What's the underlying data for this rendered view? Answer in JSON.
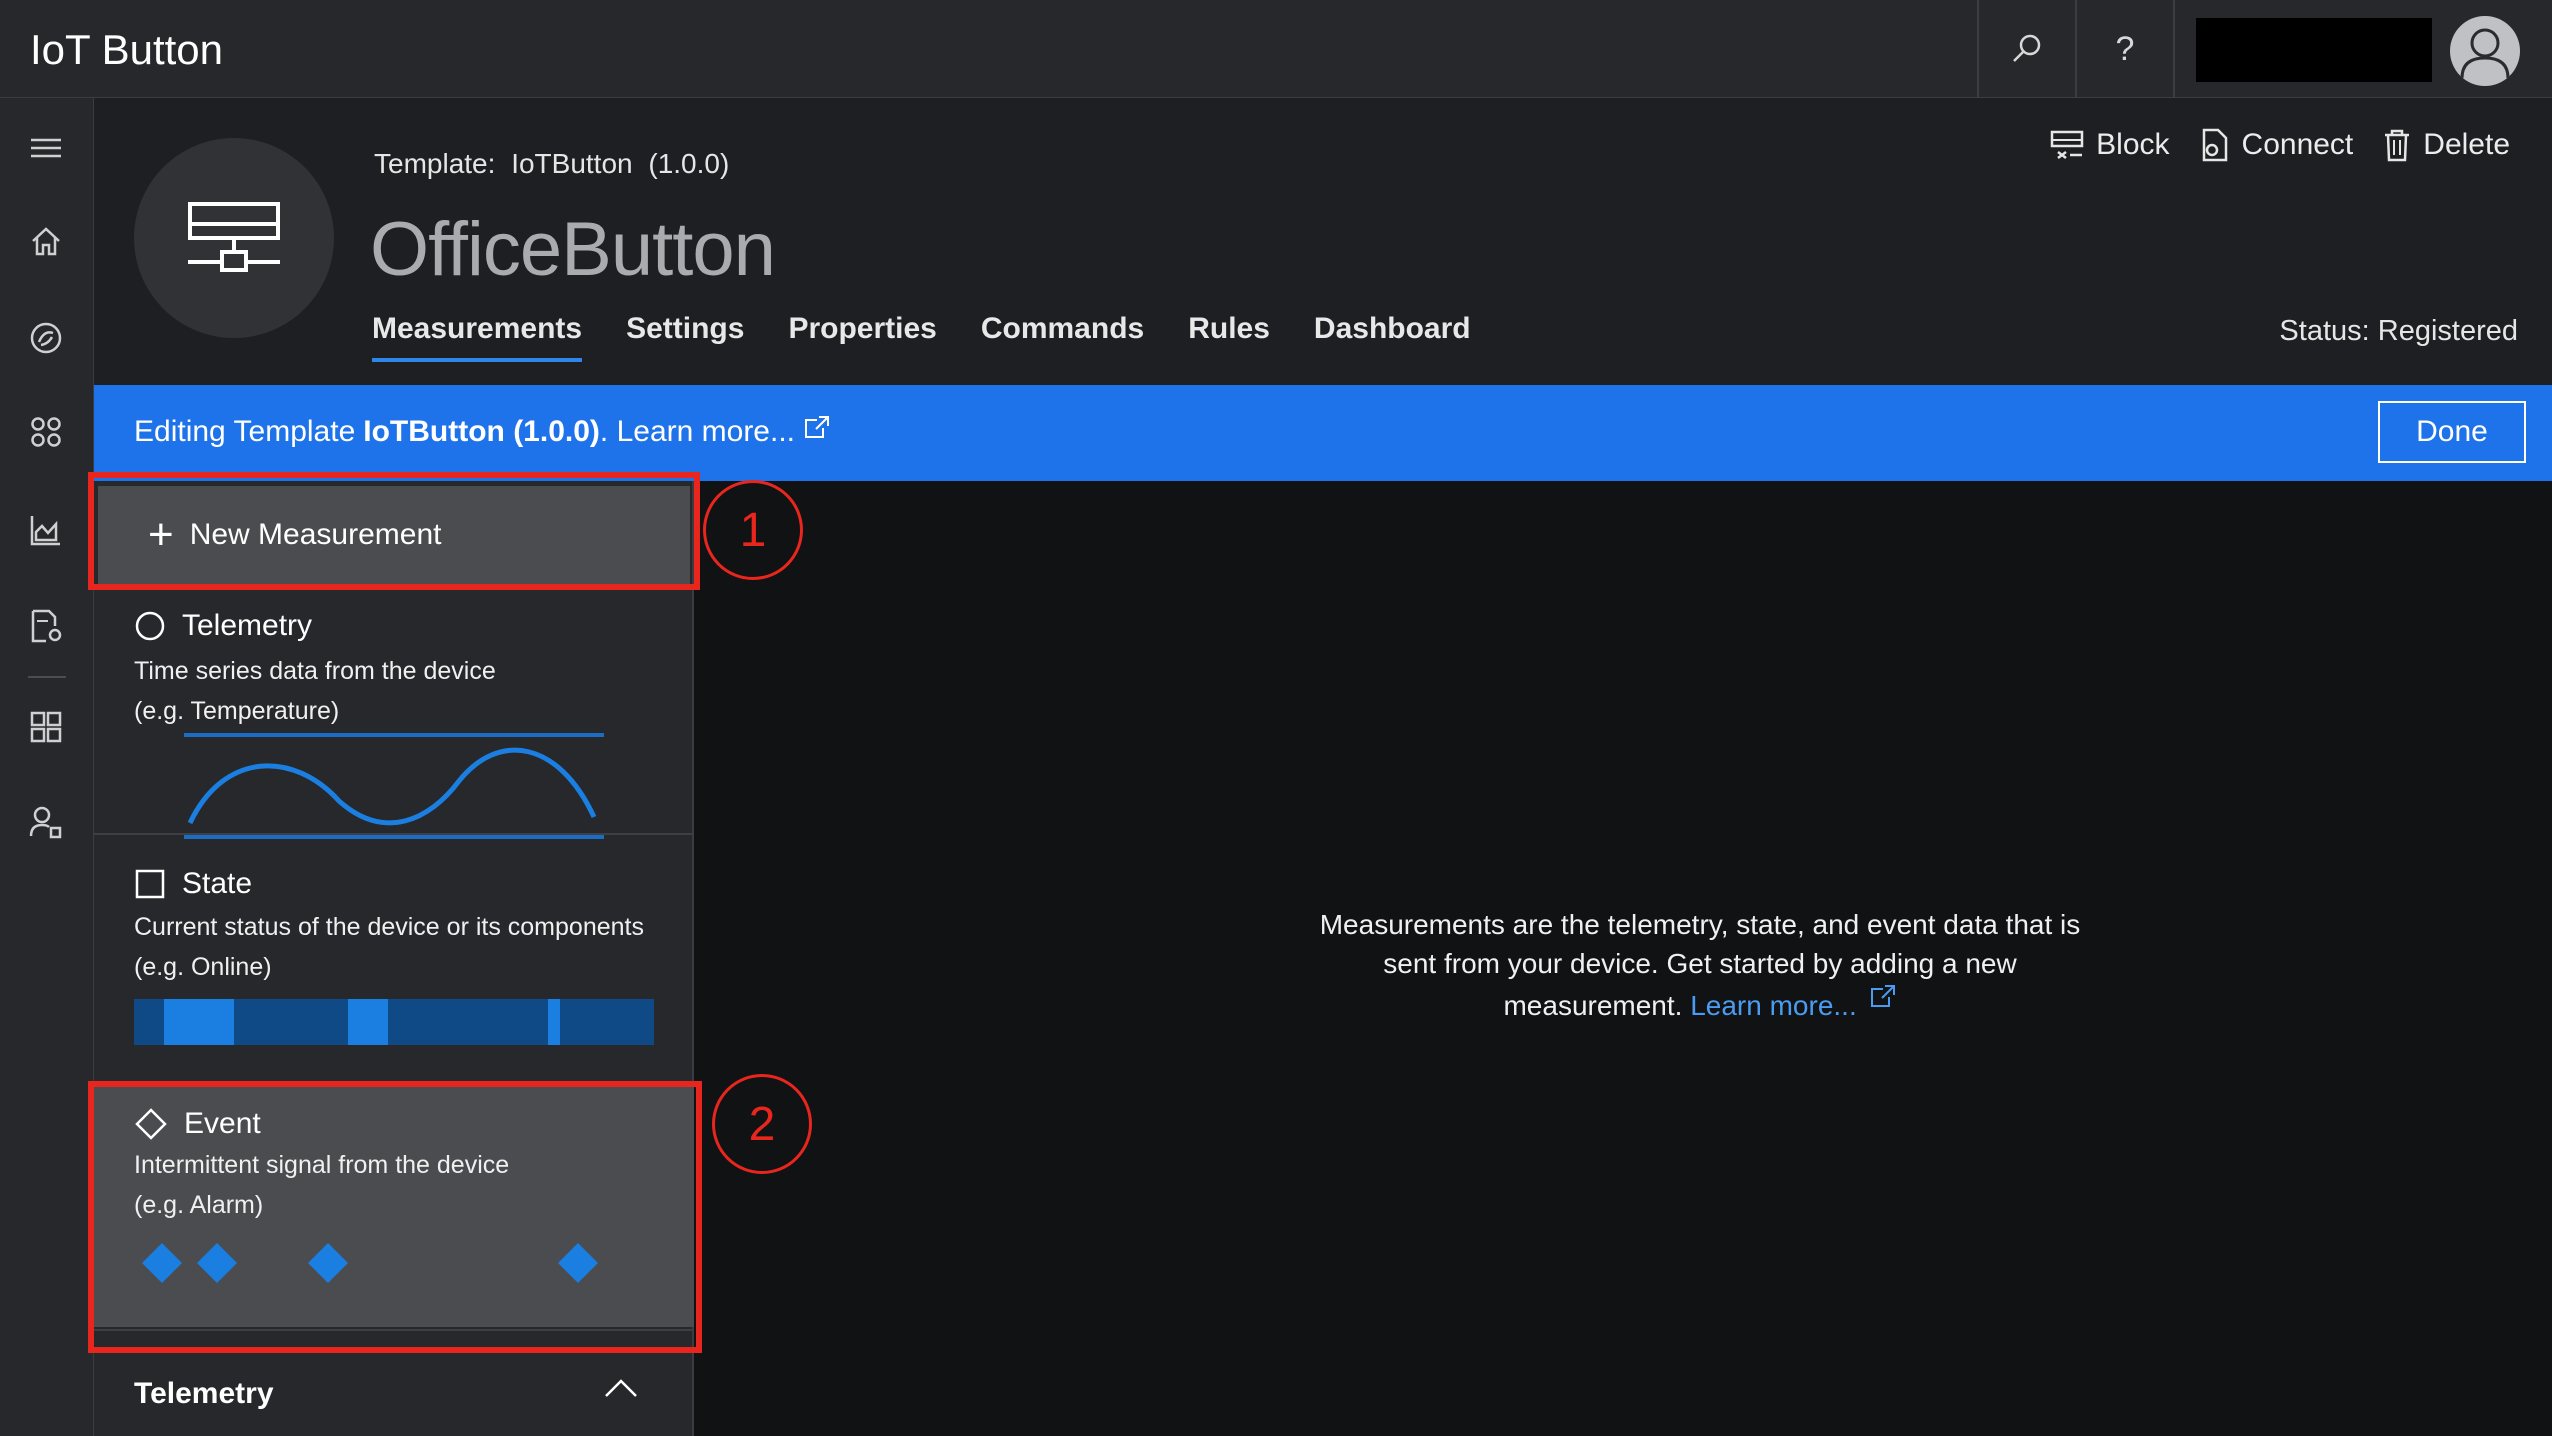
{
  "app": {
    "title": "IoT Button"
  },
  "topbar": {
    "search_icon": "search-icon",
    "help_label": "?",
    "avatar_icon": "user-icon"
  },
  "nav": {
    "items": [
      "menu-icon",
      "home-icon",
      "device-explorer-icon",
      "device-sets-icon",
      "analytics-icon",
      "jobs-icon",
      "app-builder-icon",
      "administration-icon"
    ]
  },
  "header": {
    "template_label": "Template:",
    "template_name": "IoTButton",
    "template_version": "(1.0.0)",
    "device_name": "OfficeButton",
    "status": "Status: Registered",
    "actions": {
      "block": "Block",
      "connect": "Connect",
      "delete": "Delete"
    },
    "tabs": [
      "Measurements",
      "Settings",
      "Properties",
      "Commands",
      "Rules",
      "Dashboard"
    ],
    "active_tab": "Measurements"
  },
  "banner": {
    "prefix": "Editing Template",
    "template": "IoTButton (1.0.0)",
    "link": ". Learn more...",
    "done_label": "Done"
  },
  "panel": {
    "new_measurement": "New Measurement",
    "types": [
      {
        "title": "Telemetry",
        "desc1": "Time series data from the device",
        "desc2": "(e.g. Temperature)"
      },
      {
        "title": "State",
        "desc1": "Current status of the device or its components",
        "desc2": "(e.g. Online)"
      },
      {
        "title": "Event",
        "desc1": "Intermittent signal from the device",
        "desc2": "(e.g. Alarm)"
      }
    ],
    "section_title": "Telemetry"
  },
  "main": {
    "line1": "Measurements are the telemetry, state, and event data that is",
    "line2": "sent from your device. Get started by adding a new",
    "line3": "measurement.",
    "link": "Learn more..."
  },
  "callouts": [
    "1",
    "2"
  ],
  "colors": {
    "accent": "#1e73ea",
    "callout": "#e8261d",
    "chart": "#1a7fe0"
  }
}
